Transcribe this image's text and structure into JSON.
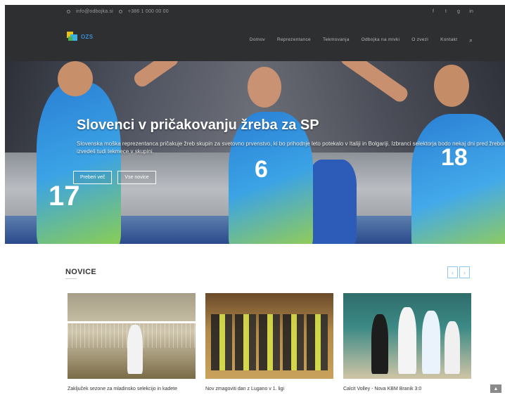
{
  "topbar": {
    "contact_1": "info@odbojka.si",
    "contact_2": "+386 1 000 00 00",
    "socials": [
      "f",
      "t",
      "g",
      "in"
    ]
  },
  "logo": {
    "text": "OZS"
  },
  "menu": {
    "items": [
      "Domov",
      "Reprezentance",
      "Tekmovanja",
      "Odbojka na mivki",
      "O zvezi",
      "Kontakt"
    ],
    "search_icon": "⌕"
  },
  "hero": {
    "title": "Slovenci v pričakovanju žreba za SP",
    "text": "Slovenska moška reprezentanca pričakuje žreb skupin za svetovno prvenstvo, ki bo prihodnje leto potekalo v Italiji in Bolgariji. Izbranci selektorja bodo nekaj dni pred žrebom izvedeli tudi tekmece v skupini.",
    "btn_1": "Preberi več",
    "btn_2": "Vse novice",
    "jersey_1": "17",
    "jersey_2": "6",
    "jersey_3": "18"
  },
  "news": {
    "title": "NOVICE",
    "prev": "‹",
    "next": "›",
    "cards": [
      {
        "caption": "Zaključek sezone za mladinsko selekcijo in kadete"
      },
      {
        "caption": "Nov zmagoviti dan z Lugano v 1. ligi"
      },
      {
        "caption": "Calcit Volley - Nova KBM Branik 3:0"
      }
    ]
  },
  "scroll_top": "▲"
}
